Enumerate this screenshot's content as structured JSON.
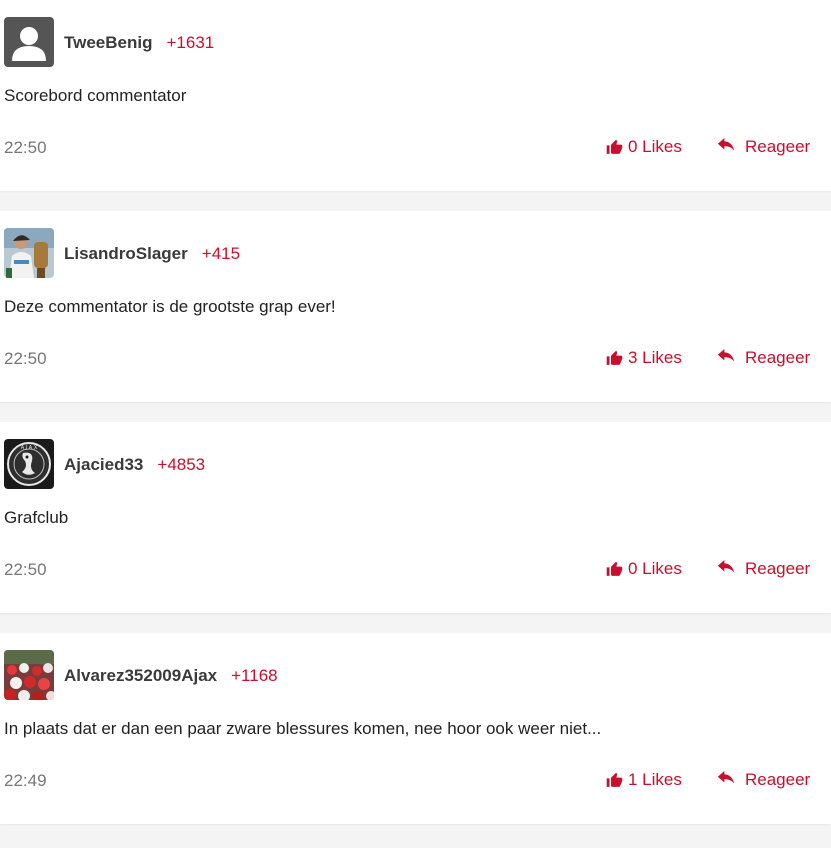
{
  "colors": {
    "accent": "#c8102e",
    "username": "#3a3a3a",
    "muted": "#777777",
    "separator": "#f4f4f4"
  },
  "icons": {
    "like": "thumbs-up-icon",
    "reply": "reply-arrow-icon"
  },
  "comments": [
    {
      "username": "TweeBenig",
      "points": "+1631",
      "text": "Scorebord commentator",
      "time": "22:50",
      "likes": "0 Likes",
      "reply": "Reageer",
      "avatar": "default-user-avatar"
    },
    {
      "username": "LisandroSlager",
      "points": "+415",
      "text": "Deze commentator is de grootste grap ever!",
      "time": "22:50",
      "likes": "3 Likes",
      "reply": "Reageer",
      "avatar": "trophy-photo-avatar"
    },
    {
      "username": "Ajacied33",
      "points": "+4853",
      "text": "Grafclub",
      "time": "22:50",
      "likes": "0 Likes",
      "reply": "Reageer",
      "avatar": "ajax-logo-avatar"
    },
    {
      "username": "Alvarez352009Ajax",
      "points": "+1168",
      "text": "In plaats dat er dan een paar zware blessures komen, nee hoor ook weer niet...",
      "time": "22:49",
      "likes": "1 Likes",
      "reply": "Reageer",
      "avatar": "crowd-photo-avatar"
    }
  ]
}
